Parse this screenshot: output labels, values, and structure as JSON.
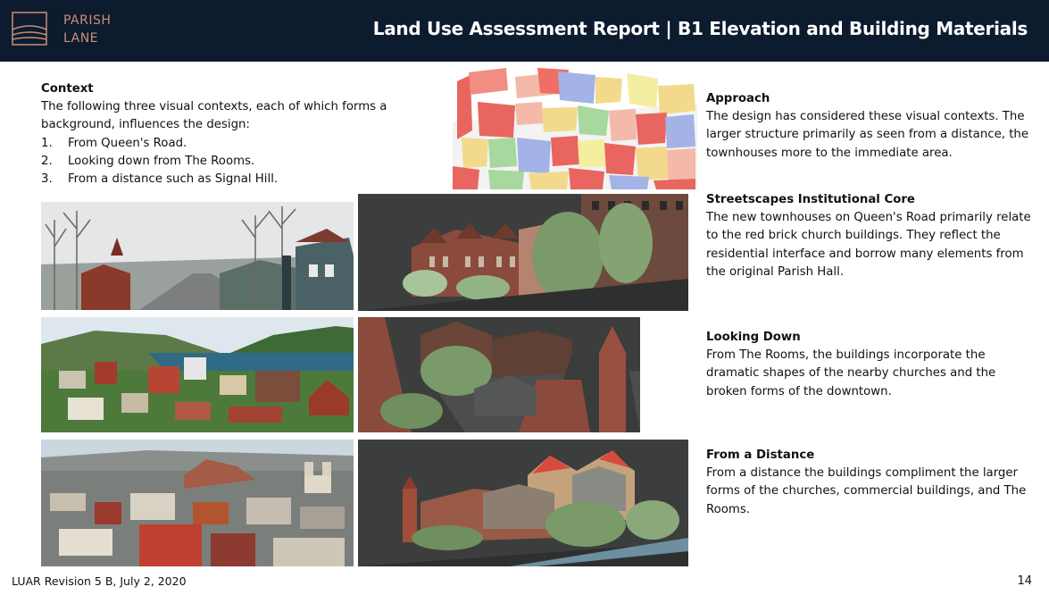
{
  "header": {
    "brand_line1": "PARISH",
    "brand_line2": "LANE",
    "title": "Land Use Assessment Report | B1  Elevation and Building Materials"
  },
  "context": {
    "heading": "Context",
    "intro": "The following three visual contexts, each of which forms a background, influences the design:",
    "items": [
      {
        "num": "1.",
        "text": "From Queen's Road."
      },
      {
        "num": "2.",
        "text": "Looking down from The Rooms."
      },
      {
        "num": "3.",
        "text": "From a distance such as Signal Hill."
      }
    ]
  },
  "approach": {
    "heading": "Approach",
    "body": "The design has considered these visual contexts. The larger structure primarily as seen from a distance, the townhouses more to the immediate area."
  },
  "streetscapes": {
    "heading": "Streetscapes Institutional Core",
    "body": "The new townhouses on Queen's Road primarily relate to the red brick church buildings. They reflect the residential interface and borrow many elements from the original Parish Hall."
  },
  "looking_down": {
    "heading": "Looking Down",
    "body": "From The Rooms, the buildings incorporate the dramatic shapes of the nearby churches and the broken forms of the downtown."
  },
  "from_distance": {
    "heading": "From a Distance",
    "body": "From a distance the buildings compliment the larger forms of the churches, commercial buildings, and The Rooms."
  },
  "footer": {
    "revision": "LUAR Revision 5 B, July 2, 2020",
    "page_number": "14"
  },
  "colors": {
    "header_bg": "#0d1b2e",
    "brand_accent": "#c98f78",
    "render_bg": "#3c3e3d"
  }
}
